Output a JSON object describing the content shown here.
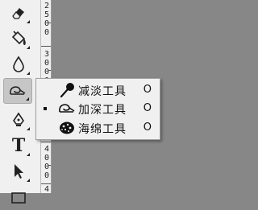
{
  "tools": [
    {
      "name": "eraser"
    },
    {
      "name": "paint-bucket"
    },
    {
      "name": "blur"
    },
    {
      "name": "dodge",
      "selected": true
    },
    {
      "name": "pen"
    },
    {
      "name": "type",
      "glyph": "T"
    },
    {
      "name": "path-selection"
    },
    {
      "name": "rectangle"
    }
  ],
  "ruler": {
    "labels": [
      "2500",
      "3000",
      "3500",
      "4000",
      "4"
    ]
  },
  "flyout": {
    "items": [
      {
        "label": "减淡工具",
        "shortcut": "O",
        "icon": "dodge-icon",
        "active": false
      },
      {
        "label": "加深工具",
        "shortcut": "O",
        "icon": "burn-icon",
        "active": true
      },
      {
        "label": "海绵工具",
        "shortcut": "O",
        "icon": "sponge-icon",
        "active": false
      }
    ]
  }
}
